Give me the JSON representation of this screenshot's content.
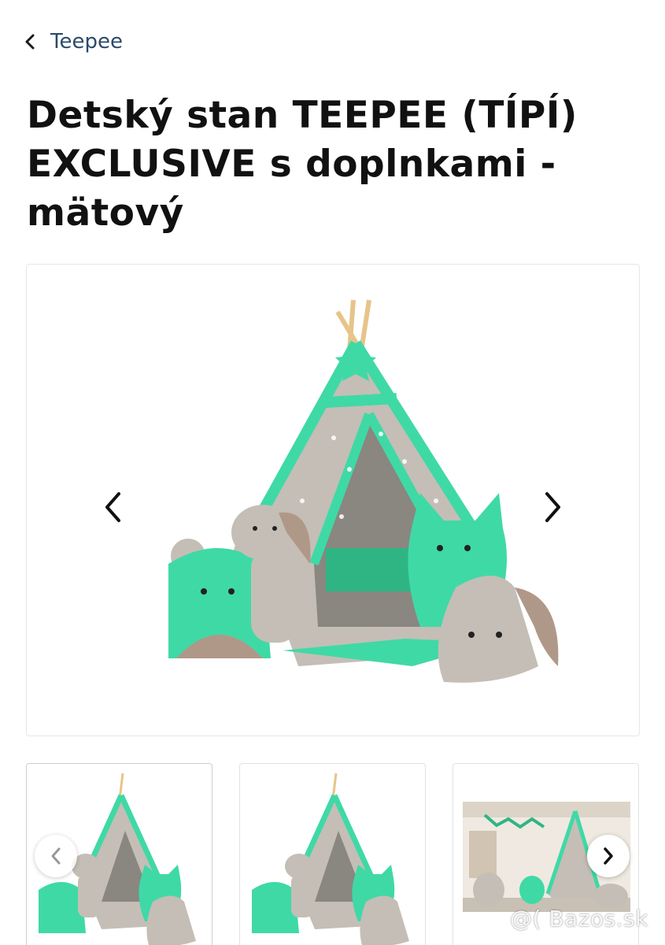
{
  "header": {
    "back_label": "Teepee"
  },
  "product": {
    "title": "Detský stan TEEPEE (TÍPÍ) EXCLUSIVE s doplnkami - mätový"
  },
  "gallery": {
    "thumbnail_count": 3,
    "selected_index": 0
  },
  "colors": {
    "mint": "#3fd9a6",
    "grey_fabric": "#b9b4ad",
    "wood": "#e6c48a",
    "link": "#2b4a6b"
  },
  "watermark": {
    "text": "@( Bazos.sk"
  }
}
